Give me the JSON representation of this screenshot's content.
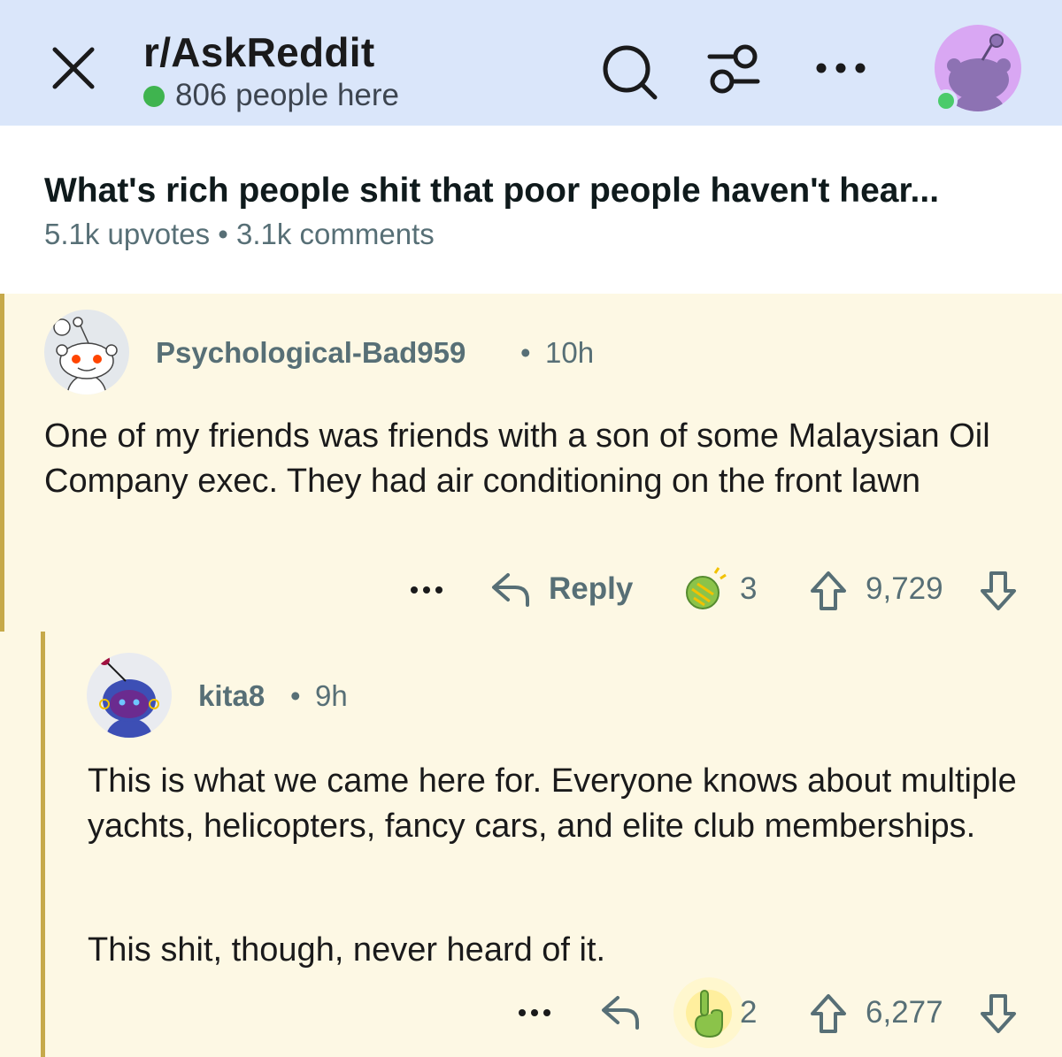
{
  "header": {
    "subreddit": "r/AskReddit",
    "online_count": "806 people here"
  },
  "post": {
    "title": "What's rich people shit that poor people haven't hear...",
    "meta": "5.1k upvotes • 3.1k comments"
  },
  "comments": [
    {
      "username": "Psychological-Bad959",
      "separator": "•",
      "time": "10h",
      "body": "One of my friends was friends with a son of some Malaysian Oil Company exec. They had air conditioning on the front lawn",
      "reply_label": "Reply",
      "award_count": "3",
      "score": "9,729"
    },
    {
      "username": "kita8",
      "separator": "•",
      "time": "9h",
      "body_p1": "This is what we came here for. Everyone knows about multiple yachts, helicopters, fancy cars, and elite club memberships.",
      "body_p2": "This shit, though, never heard of it.",
      "award_count": "2",
      "score": "6,277"
    }
  ],
  "colors": {
    "header_bg": "#dae6fa",
    "comment_bg": "#fdf8e4",
    "thread_line": "#c6a94a",
    "online_green": "#3fb44f",
    "meta_gray": "#576f76"
  },
  "icons": [
    "close-icon",
    "search-icon",
    "filter-icon",
    "more-icon",
    "reply-icon",
    "award-icon",
    "upvote-icon",
    "downvote-icon"
  ]
}
